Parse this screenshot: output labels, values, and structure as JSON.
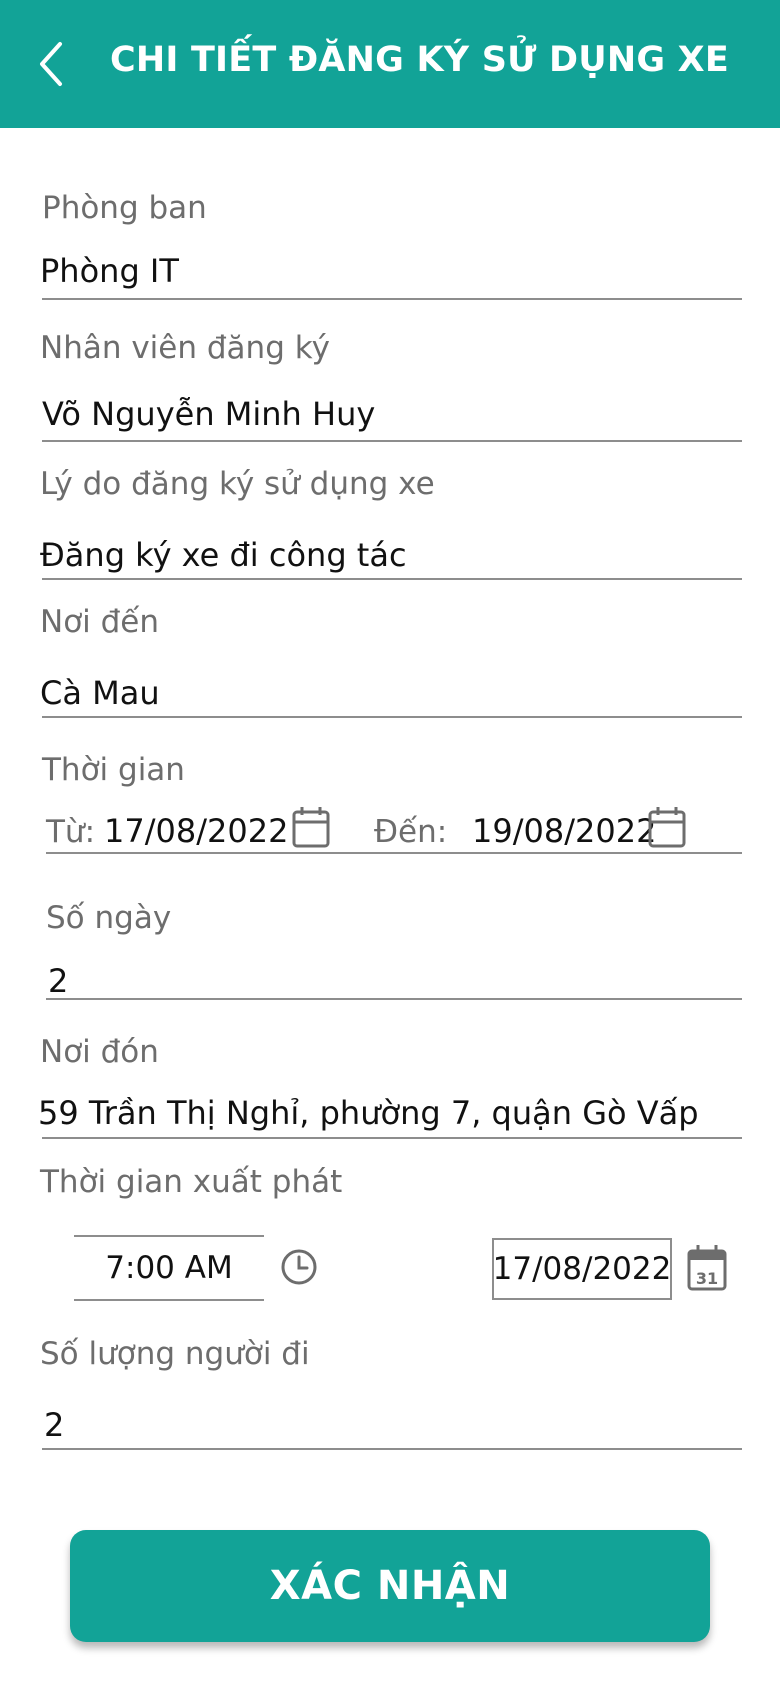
{
  "header": {
    "title": "CHI TIẾT ĐĂNG KÝ SỬ DỤNG XE"
  },
  "department": {
    "label": "Phòng ban",
    "value": "Phòng IT"
  },
  "employee": {
    "label": "Nhân viên đăng ký",
    "value": "Võ Nguyễn Minh Huy"
  },
  "reason": {
    "label": "Lý do đăng ký sử dụng xe",
    "value": "Đăng ký xe đi công tác"
  },
  "destination": {
    "label": "Nơi đến",
    "value": "Cà Mau"
  },
  "period": {
    "label": "Thời gian",
    "from_label": "Từ:",
    "from_value": "17/08/2022",
    "to_label": "Đến:",
    "to_value": "19/08/2022"
  },
  "days": {
    "label": "Số ngày",
    "value": "2"
  },
  "pickup": {
    "label": "Nơi đón",
    "value": "59 Trần Thị Nghỉ, phường 7, quận Gò Vấp"
  },
  "departure": {
    "label": "Thời gian xuất phát",
    "time": "7:00 AM",
    "date": "17/08/2022",
    "calendar_day": "31"
  },
  "passengers": {
    "label": "Số lượng người đi",
    "value": "2"
  },
  "actions": {
    "confirm_label": "XÁC NHẬN"
  },
  "colors": {
    "primary": "#12a397",
    "label": "#6d6d6d",
    "line": "#8d8d8d"
  },
  "icons": [
    "back-arrow-icon",
    "calendar-icon",
    "clock-icon",
    "calendar-31-icon"
  ]
}
